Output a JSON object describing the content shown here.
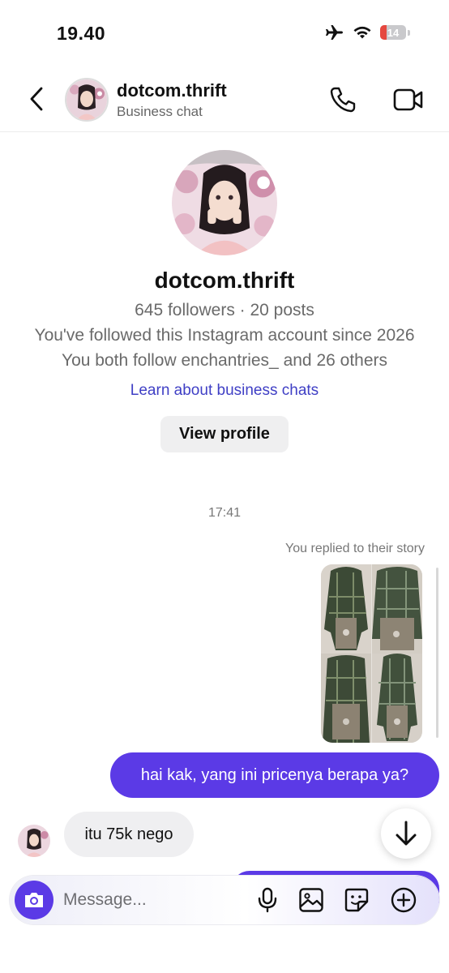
{
  "status_bar": {
    "time": "19.40",
    "battery": "14"
  },
  "header": {
    "name": "dotcom.thrift",
    "subtitle": "Business chat"
  },
  "profile": {
    "name": "dotcom.thrift",
    "stats": "645 followers · 20 posts",
    "followed_since": "You've followed this Instagram account since 2026",
    "mutual": "You both follow enchantries_ and 26 others",
    "learn_link": "Learn about business chats",
    "view_profile_label": "View profile"
  },
  "conversation": {
    "timestamp": "17:41",
    "story_reply_note": "You replied to their story",
    "messages": [
      {
        "from": "me",
        "text": "hai kak, yang ini pricenya berapa ya?"
      },
      {
        "from": "them",
        "text": "itu 75k nego"
      }
    ]
  },
  "composer": {
    "placeholder": "Message...",
    "icons": [
      "camera-icon",
      "microphone-icon",
      "gallery-icon",
      "sticker-icon",
      "plus-icon"
    ]
  },
  "colors": {
    "accent": "#5b3ae6",
    "link": "#3f3fc5",
    "battery_low": "#e5483f"
  }
}
